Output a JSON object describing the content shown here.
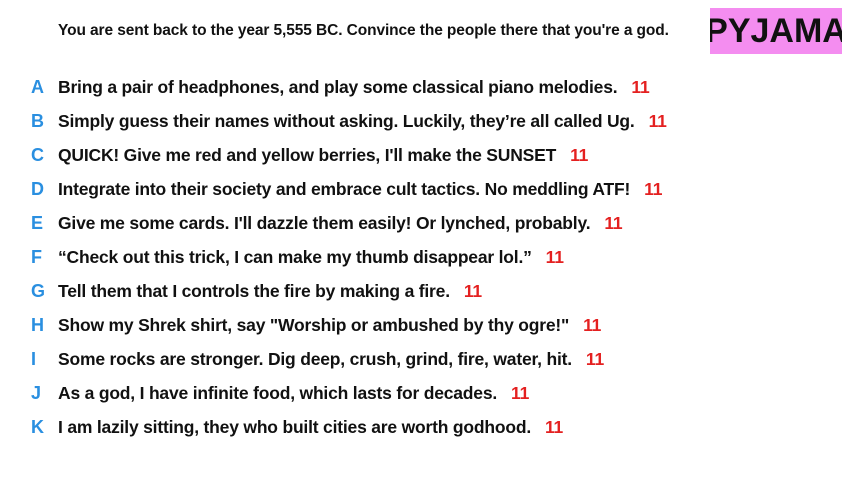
{
  "prompt": "You are sent back to the year 5,555 BC. Convince the people there that you're a god.",
  "logo": {
    "text": "PYJAMA",
    "background": "#f48df0"
  },
  "colors": {
    "letter": "#2a8fe0",
    "count": "#e42020",
    "text": "#111111"
  },
  "options": [
    {
      "letter": "A",
      "text": "Bring a pair of headphones, and play some classical piano melodies.",
      "count": "11"
    },
    {
      "letter": "B",
      "text": "Simply guess their names without asking. Luckily, they’re all called Ug.",
      "count": "11"
    },
    {
      "letter": "C",
      "text": "QUICK! Give me red and yellow berries, I'll make the SUNSET",
      "count": "11"
    },
    {
      "letter": "D",
      "text": "Integrate into their society and embrace cult tactics. No meddling ATF!",
      "count": "11"
    },
    {
      "letter": "E",
      "text": "Give me some cards. I'll dazzle them easily! Or lynched, probably.",
      "count": "11"
    },
    {
      "letter": "F",
      "text": "“Check out this trick, I can make my thumb disappear lol.”",
      "count": "11"
    },
    {
      "letter": "G",
      "text": "Tell them that I controls the fire by making a fire.",
      "count": "11"
    },
    {
      "letter": "H",
      "text": "Show my Shrek shirt, say \"Worship or ambushed by thy ogre!\"",
      "count": "11"
    },
    {
      "letter": "I",
      "text": "Some rocks are stronger. Dig deep, crush, grind, fire, water, hit.",
      "count": "11"
    },
    {
      "letter": "J",
      "text": "As a god, I have infinite food, which lasts for decades.",
      "count": "11"
    },
    {
      "letter": "K",
      "text": "I am lazily sitting, they who built cities are worth godhood.",
      "count": "11"
    }
  ]
}
